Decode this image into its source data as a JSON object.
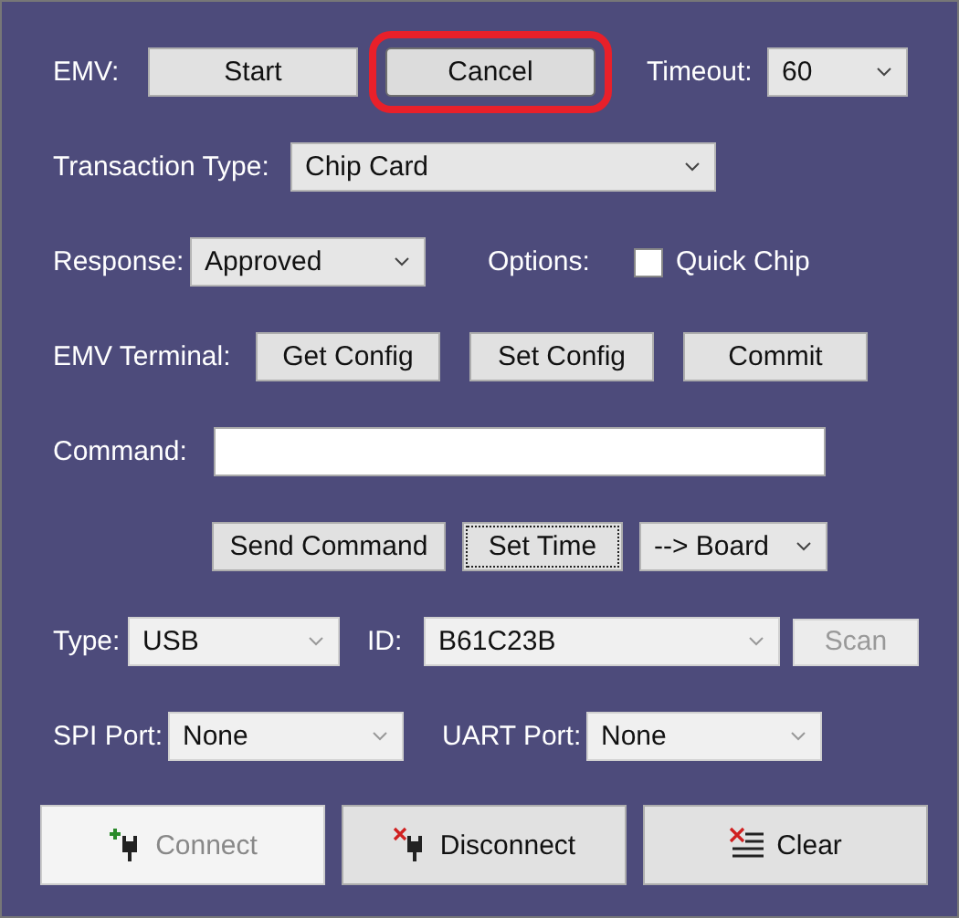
{
  "emv": {
    "label": "EMV:",
    "buttons": [
      {
        "label": "Start",
        "highlighted": false
      },
      {
        "label": "Cancel",
        "highlighted": true
      }
    ],
    "timeout": {
      "label": "Timeout:",
      "value": "60"
    }
  },
  "transaction_type": {
    "label": "Transaction Type:",
    "value": "Chip Card"
  },
  "response": {
    "label": "Response:",
    "value": "Approved"
  },
  "options": {
    "label": "Options:",
    "checkbox": {
      "label": "Quick Chip",
      "checked": false
    }
  },
  "emv_terminal": {
    "label": "EMV Terminal:",
    "buttons": [
      "Get Config",
      "Set Config",
      "Commit"
    ]
  },
  "command": {
    "label": "Command:"
  },
  "command_actions": {
    "buttons": [
      {
        "label": "Send Command",
        "focused": false
      },
      {
        "label": "Set Time",
        "focused": true
      }
    ],
    "target": {
      "value": "--> Board"
    }
  },
  "device": {
    "type": {
      "label": "Type:",
      "value": "USB"
    },
    "id": {
      "label": "ID:",
      "value": "B61C23B"
    },
    "scan": {
      "label": "Scan",
      "disabled": true
    }
  },
  "ports": {
    "spi": {
      "label": "SPI Port:",
      "value": "None"
    },
    "uart": {
      "label": "UART Port:",
      "value": "None"
    }
  },
  "actions": [
    {
      "kind": "connect",
      "label": "Connect",
      "disabled": true
    },
    {
      "kind": "disconnect",
      "label": "Disconnect",
      "disabled": false
    },
    {
      "kind": "clear",
      "label": "Clear",
      "disabled": false
    }
  ]
}
